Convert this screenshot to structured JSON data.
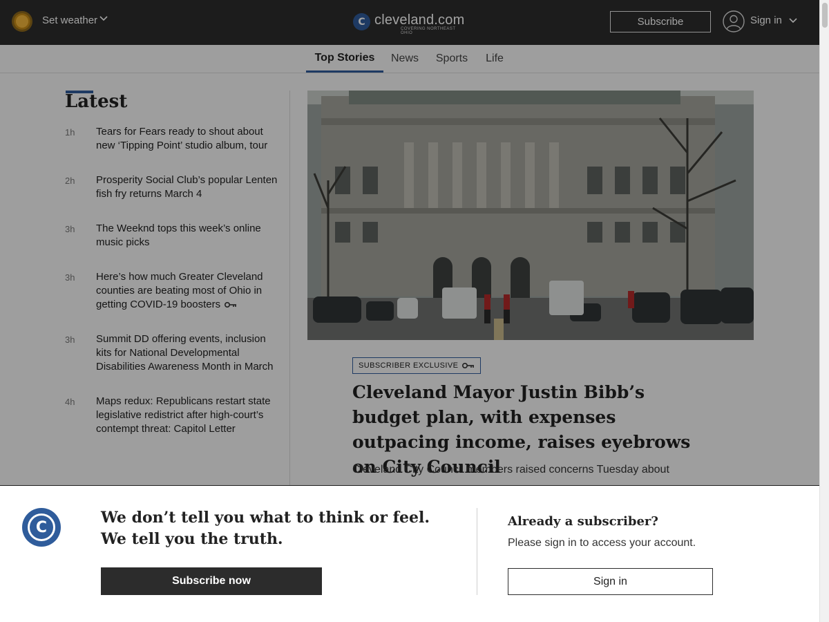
{
  "header": {
    "weather_label": "Set weather",
    "logo_name": "cleveland.com",
    "logo_mark": "C",
    "logo_tagline": "COVERING NORTHEAST OHIO",
    "subscribe_label": "Subscribe",
    "signin_label": "Sign in",
    "icons": [
      "sun-icon",
      "chevron-down-icon",
      "user-icon"
    ]
  },
  "nav": {
    "tabs": [
      {
        "label": "Top Stories",
        "active": true
      },
      {
        "label": "News",
        "active": false
      },
      {
        "label": "Sports",
        "active": false
      },
      {
        "label": "Life",
        "active": false
      }
    ]
  },
  "latest": {
    "title": "Latest",
    "items": [
      {
        "time": "1h",
        "headline": "Tears for Fears ready to shout about new ‘Tipping Point’ studio album, tour",
        "premium": false
      },
      {
        "time": "2h",
        "headline": "Prosperity Social Club’s popular Lenten fish fry returns March 4",
        "premium": false
      },
      {
        "time": "3h",
        "headline": "The Weeknd tops this week’s online music picks",
        "premium": false
      },
      {
        "time": "3h",
        "headline": "Here’s how much Greater Cleveland counties are beating most of Ohio in getting COVID-19 boosters",
        "premium": true
      },
      {
        "time": "3h",
        "headline": "Summit DD offering events, inclusion kits for National Developmental Disabilities Awareness Month in March",
        "premium": false
      },
      {
        "time": "4h",
        "headline": "Maps redux: Republicans restart state legislative redistrict after high-court’s contempt threat: Capitol Letter",
        "premium": false
      }
    ]
  },
  "top_story": {
    "badge": "SUBSCRIBER EXCLUSIVE",
    "headline": "Cleveland Mayor Justin Bibb’s budget plan, with expenses outpacing income, raises eyebrows on City Council",
    "summary": "Cleveland City Council members raised concerns Tuesday about"
  },
  "paywall": {
    "logo_mark": "C",
    "tagline_line1": "We don’t tell you what to think or feel.",
    "tagline_line2": "We tell you the truth.",
    "subscribe_label": "Subscribe now",
    "already_title": "Already a subscriber?",
    "already_text": "Please sign in to access your account.",
    "signin_label": "Sign in"
  },
  "colors": {
    "header_bg": "#2c2c2c",
    "accent": "#2f5c9b",
    "page_bg": "#f7f7f7"
  }
}
